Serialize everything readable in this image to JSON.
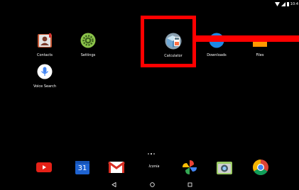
{
  "status_bar": {
    "time": "10:4",
    "icons": [
      "wifi-icon",
      "signal-icon",
      "battery-icon"
    ]
  },
  "home_apps": [
    {
      "id": "contacts",
      "label": "Contacts",
      "icon": "contacts-icon"
    },
    {
      "id": "settings",
      "label": "Settings",
      "icon": "gear-icon"
    },
    {
      "id": "calculator",
      "label": "Calculator",
      "icon": "calculator-icon"
    },
    {
      "id": "downloads",
      "label": "Downloads",
      "icon": "download-icon"
    },
    {
      "id": "files",
      "label": "Files",
      "icon": "folder-icon"
    },
    {
      "id": "voice-search",
      "label": "Voice Search",
      "icon": "microphone-icon"
    }
  ],
  "page_indicator": {
    "pages": 3,
    "current": 2
  },
  "dock": [
    {
      "id": "youtube",
      "icon": "youtube-icon"
    },
    {
      "id": "calendar",
      "icon": "calendar-icon",
      "text": "31"
    },
    {
      "id": "gmail",
      "icon": "gmail-icon"
    },
    {
      "id": "iconia",
      "icon": "iconia-logo",
      "text": "Iconia"
    },
    {
      "id": "photos",
      "icon": "photos-icon"
    },
    {
      "id": "camera",
      "icon": "camera-icon"
    },
    {
      "id": "chrome",
      "icon": "chrome-icon"
    }
  ],
  "nav_bar": {
    "buttons": [
      "back-icon",
      "home-icon",
      "recents-icon"
    ]
  },
  "colors": {
    "background": "#000000",
    "highlight": "#ff0000"
  }
}
